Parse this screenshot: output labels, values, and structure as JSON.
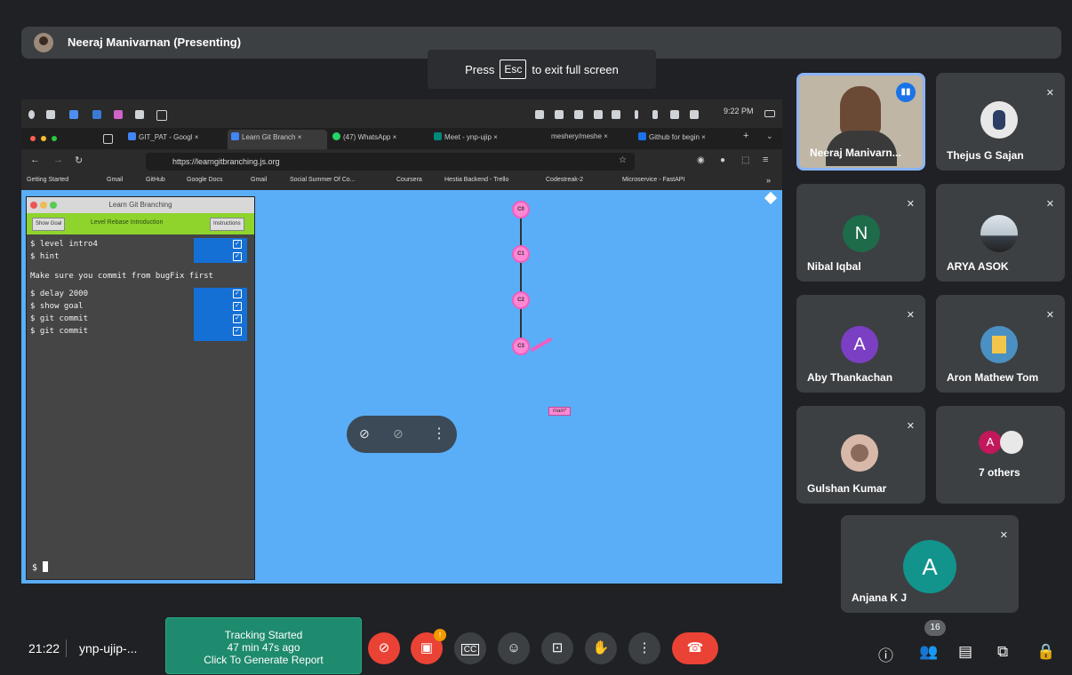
{
  "presenter": {
    "name": "Neeraj Manivarnan (Presenting)"
  },
  "fullscreen_toast": {
    "prefix": "Press",
    "key": "Esc",
    "suffix": "to exit full screen"
  },
  "shared_screen": {
    "os_time": "9:22 PM",
    "browser_tabs": [
      {
        "label": "GIT_PAT - Googl",
        "color": "#4285f4"
      },
      {
        "label": "Learn Git Branch",
        "color": "#4285f4"
      },
      {
        "label": "(47) WhatsApp",
        "color": "#25d366"
      },
      {
        "label": "Meet - ynp-ujip",
        "color": "#00897b"
      },
      {
        "label": "meshery/meshe",
        "color": "#7b1fa2"
      },
      {
        "label": "Github for begin",
        "color": "#1a73e8"
      }
    ],
    "url": "https://learngitbranching.js.org",
    "bookmarks": [
      "Getting Started",
      "Gmail",
      "GitHub",
      "Google Docs",
      "Gmail",
      "Social Summer Of Co...",
      "Coursera",
      "Hestia Backend - Trello",
      "Codestreak-2",
      "Microservice - FastAPI"
    ],
    "terminal": {
      "title": "Learn Git Branching",
      "show_goal_btn": "Show Goal",
      "level_label": "Level Rebase Introduction",
      "instructions_btn": "Instructions",
      "commands_a": [
        "$ level intro4",
        "$ hint"
      ],
      "message": "Make sure you commit from bugFix first",
      "commands_b": [
        "$ delay 2000",
        "$ show goal",
        "$ git commit",
        "$ git commit"
      ],
      "prompt": "$"
    },
    "git_graph": {
      "nodes": [
        "C0",
        "C1",
        "C2",
        "C3"
      ],
      "branch_label": "main*"
    },
    "zoom_strip": "• · • · •"
  },
  "participants": [
    {
      "name": "Neeraj Manivarn...",
      "type": "video",
      "speaking": true
    },
    {
      "name": "Thejus G Sajan",
      "type": "photo",
      "muted": true
    },
    {
      "name": "Nibal Iqbal",
      "initial": "N",
      "color": "#1e6b4a",
      "muted": true
    },
    {
      "name": "ARYA ASOK",
      "type": "photo",
      "muted": true
    },
    {
      "name": "Aby Thankachan",
      "initial": "A",
      "color": "#7b3fc4",
      "muted": true
    },
    {
      "name": "Aron Mathew Tom",
      "type": "photo",
      "muted": true
    },
    {
      "name": "Gulshan Kumar",
      "type": "photo",
      "muted": true
    },
    {
      "name": "7 others",
      "initial": "A",
      "color": "#c2185b"
    },
    {
      "name": "Anjana K J",
      "initial": "A",
      "color": "#12948d",
      "muted": true
    }
  ],
  "bottom": {
    "clock": "21:22",
    "meeting_code": "ynp-ujip-...",
    "tracking": {
      "line1": "Tracking Started",
      "line2": "47 min 47s ago",
      "line3": "Click To Generate Report"
    },
    "camera_badge": "!",
    "people_count": "16"
  }
}
